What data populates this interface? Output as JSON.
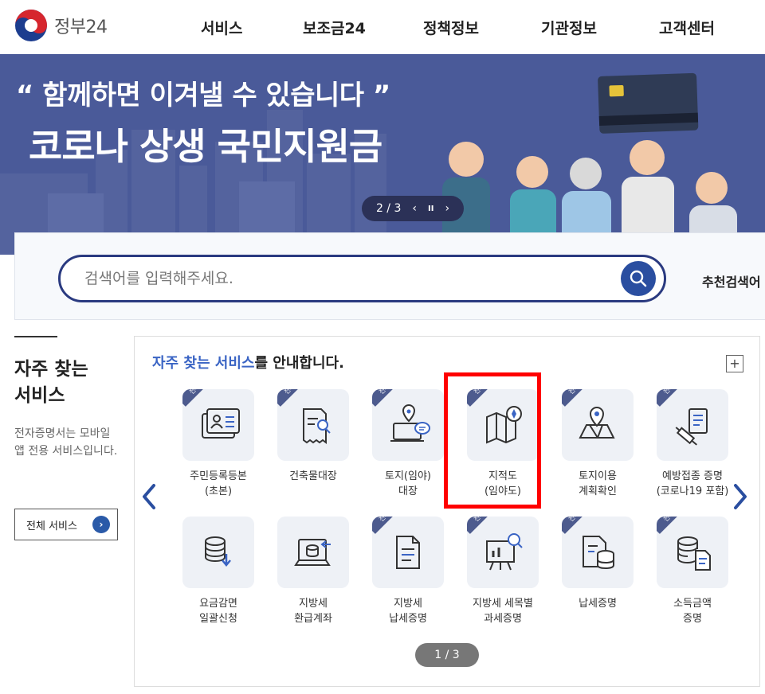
{
  "header": {
    "logo_text": "정부24",
    "nav": [
      "서비스",
      "보조금24",
      "정책정보",
      "기관정보",
      "고객센터"
    ]
  },
  "banner": {
    "quote": "“ 함께하면 이겨낼 수 있습니다 ”",
    "title": "코로나 상생 국민지원금",
    "slider": {
      "position": "2 / 3",
      "prev": "‹",
      "pause": "II",
      "next": "›"
    }
  },
  "search": {
    "placeholder": "검색어를 입력해주세요.",
    "recommend_label": "추천검색어"
  },
  "left": {
    "title_line1": "자주 찾는",
    "title_line2": "서비스",
    "desc": "전자증명서는 모바일 앱 전용 서비스입니다.",
    "all_button": "전체 서비스"
  },
  "services": {
    "heading_highlight": "자주 찾는 서비스",
    "heading_rest": "를 안내합니다.",
    "plus": "+",
    "cert_ribbon": "전자증명서",
    "pager": "1 / 3",
    "tiles": [
      {
        "label": "주민등록등본\n(초본)",
        "cert": true,
        "icon": "id-card-icon"
      },
      {
        "label": "건축물대장",
        "cert": true,
        "icon": "document-search-icon"
      },
      {
        "label": "토지(임야)\n대장",
        "cert": true,
        "icon": "land-chat-icon"
      },
      {
        "label": "지적도\n(임야도)",
        "cert": true,
        "icon": "map-compass-icon"
      },
      {
        "label": "토지이용\n계획확인",
        "cert": true,
        "icon": "map-pin-icon"
      },
      {
        "label": "예방접종 증명\n(코로나19 포함)",
        "cert": true,
        "icon": "vaccine-icon"
      },
      {
        "label": "요금감면\n일괄신청",
        "cert": false,
        "icon": "coins-download-icon"
      },
      {
        "label": "지방세\n환급계좌",
        "cert": false,
        "icon": "laptop-coins-icon"
      },
      {
        "label": "지방세\n납세증명",
        "cert": true,
        "icon": "document-icon"
      },
      {
        "label": "지방세 세목별\n과세증명",
        "cert": true,
        "icon": "presentation-search-icon"
      },
      {
        "label": "납세증명",
        "cert": true,
        "icon": "document-coins-icon"
      },
      {
        "label": "소득금액\n증명",
        "cert": true,
        "icon": "coins-document-icon"
      }
    ]
  },
  "colors": {
    "brand_blue": "#2a4ea0",
    "banner_bg": "#4a5a99",
    "highlight_red": "#ff0000"
  }
}
